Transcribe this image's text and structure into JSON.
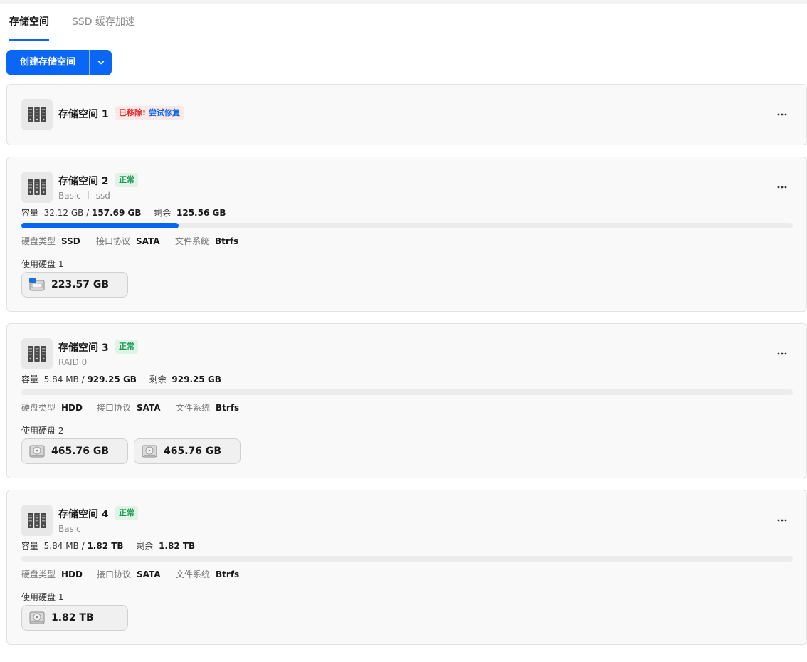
{
  "tabs": [
    {
      "label": "存储空间",
      "active": true
    },
    {
      "label": "SSD 缓存加速",
      "active": false
    }
  ],
  "toolbar": {
    "create_label": "创建存储空间"
  },
  "colors": {
    "accent": "#0a66f5",
    "ok_text": "#1f9a56",
    "ok_bg": "#dff3e6",
    "error": "#e03030"
  },
  "labels": {
    "capacity": "容量",
    "remaining": "剩余",
    "disk_type": "硬盘类型",
    "protocol": "接口协议",
    "filesystem": "文件系统",
    "used_disks": "使用硬盘"
  },
  "pools": [
    {
      "name": "存储空间 1",
      "status_error": "已移除!",
      "repair_label": "尝试修复"
    },
    {
      "name": "存储空间 2",
      "status": "正常",
      "sub1": "Basic",
      "sub2": "ssd",
      "used": "32.12 GB",
      "total": "157.69 GB",
      "free": "125.56 GB",
      "usage_fraction": 0.2037,
      "disk_type": "SSD",
      "protocol": "SATA",
      "filesystem": "Btrfs",
      "disk_count": "1",
      "disks": [
        {
          "size": "223.57 GB",
          "icon": "ssd-drive-icon"
        }
      ]
    },
    {
      "name": "存储空间 3",
      "status": "正常",
      "sub1": "RAID 0",
      "used": "5.84 MB",
      "total": "929.25 GB",
      "free": "929.25 GB",
      "usage_fraction": 0.0,
      "disk_type": "HDD",
      "protocol": "SATA",
      "filesystem": "Btrfs",
      "disk_count": "2",
      "disks": [
        {
          "size": "465.76 GB",
          "icon": "hdd-drive-icon"
        },
        {
          "size": "465.76 GB",
          "icon": "hdd-drive-icon"
        }
      ]
    },
    {
      "name": "存储空间 4",
      "status": "正常",
      "sub1": "Basic",
      "used": "5.84 MB",
      "total": "1.82 TB",
      "free": "1.82 TB",
      "usage_fraction": 0.0,
      "disk_type": "HDD",
      "protocol": "SATA",
      "filesystem": "Btrfs",
      "disk_count": "1",
      "disks": [
        {
          "size": "1.82 TB",
          "icon": "hdd-drive-icon"
        }
      ]
    }
  ]
}
